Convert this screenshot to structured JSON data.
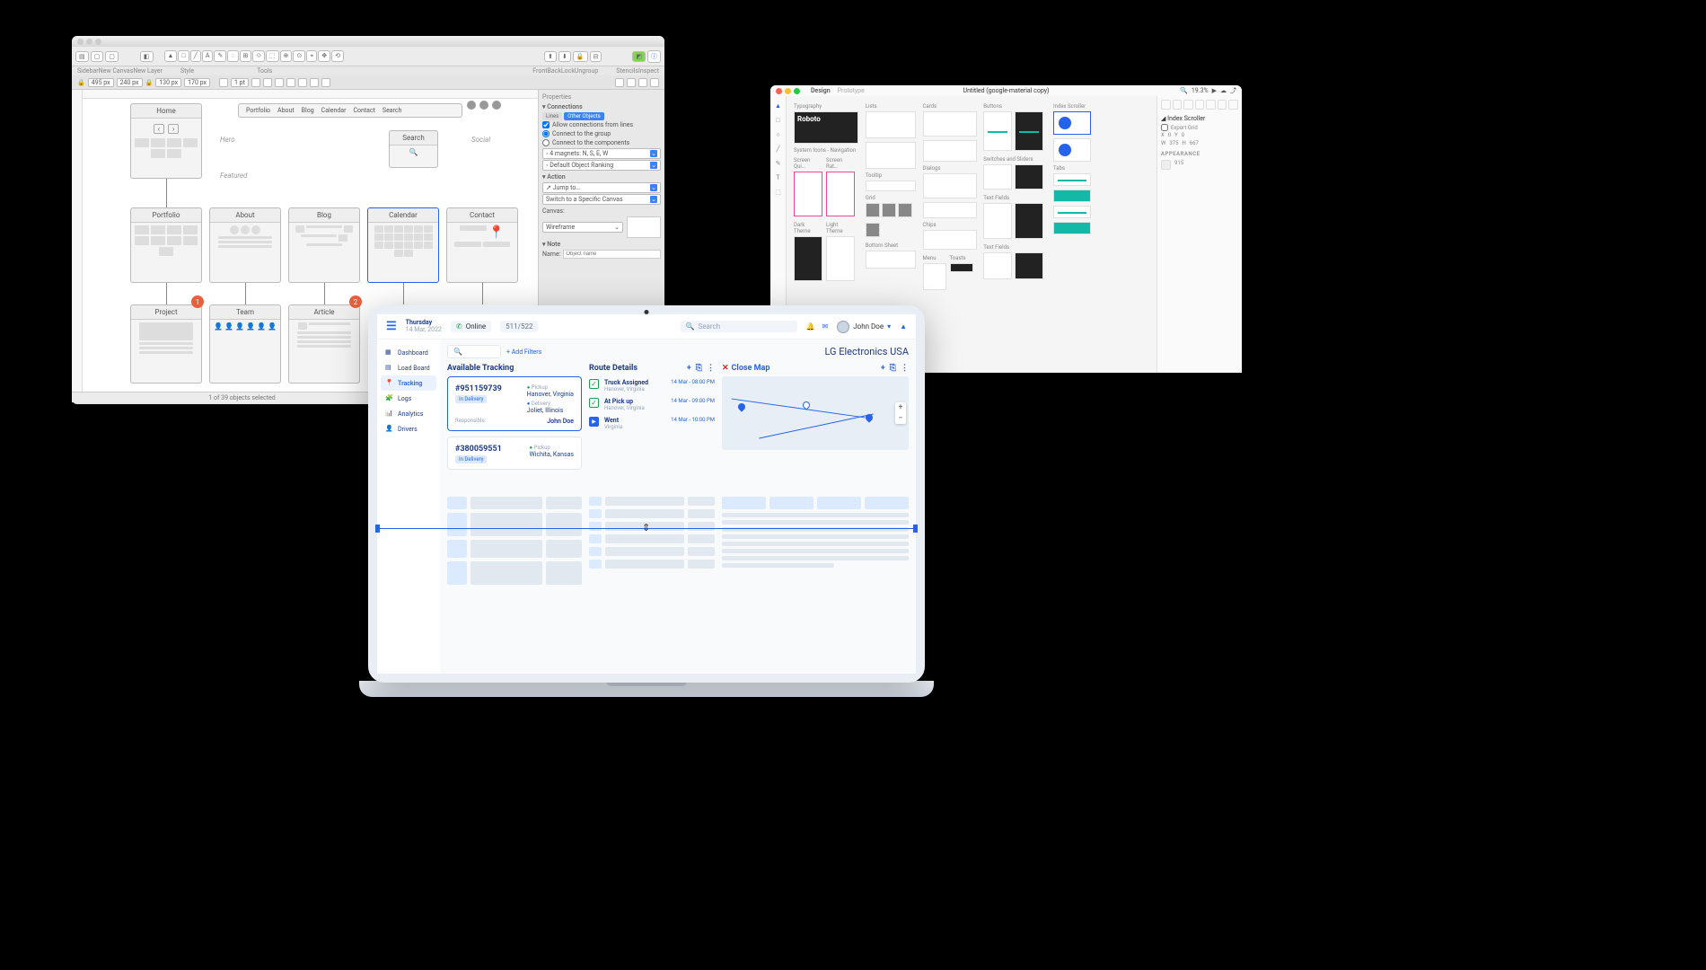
{
  "win1": {
    "toolbar_labels": {
      "sidebar": "Sidebar",
      "new_canvas": "New Canvas",
      "new_layer": "New Layer",
      "style": "Style",
      "tools": "Tools",
      "front": "Front",
      "back": "Back",
      "lock": "Lock",
      "ungroup": "Ungroup",
      "stencils": "Stencils",
      "inspect": "Inspect"
    },
    "optrow": {
      "x": "495 px",
      "y": "240 px",
      "w": "130 px",
      "h": "170 px",
      "stroke": "1 pt"
    },
    "wf": {
      "nav": [
        "Portfolio",
        "About",
        "Blog",
        "Calendar",
        "Contact",
        "Search"
      ],
      "home": "Home",
      "search_box": "Search",
      "labels": {
        "hero": "Hero",
        "featured": "Featured",
        "social": "Social"
      },
      "row1": [
        "Portfolio",
        "About",
        "Blog",
        "Calendar",
        "Contact"
      ],
      "row2": [
        "Project",
        "Team",
        "Article"
      ],
      "badge1": "1",
      "badge2": "2"
    },
    "status": "1 of 39 objects selected",
    "props": {
      "properties": "Properties",
      "connections": "Connections",
      "lines": "Lines",
      "other": "Other Objects",
      "allow": "Allow connections from lines",
      "c_group": "Connect to the group",
      "c_comp": "Connect to the components",
      "magnets": "4 magnets: N, S, E, W",
      "rank": "Default Object Ranking",
      "action": "Action",
      "jump": "Jump to…",
      "switch": "Switch to a Specific Canvas",
      "canvas": "Canvas:",
      "canvas_val": "Wireframe",
      "note": "Note",
      "name": "Name:",
      "name_ph": "Object name"
    }
  },
  "win2": {
    "tabs": {
      "design": "Design",
      "prototype": "Prototype"
    },
    "title": "Untitled (google-material copy)",
    "zoom": "19.3%",
    "sections": {
      "typography": "Typography",
      "lists": "Lists",
      "cards": "Cards",
      "buttons": "Buttons",
      "index": "Index Scroller",
      "sys_icons": "System Icons - Navigation",
      "dialogs": "Dialogs",
      "switches": "Switches and Sliders",
      "tabs": "Tabs",
      "screen_qui": "Screen Qui…",
      "screen_rat": "Screen Rat…",
      "tooltip": "Tooltip",
      "grid": "Grid",
      "dark": "Dark Theme",
      "light": "Light Theme",
      "chips": "Chips",
      "textfields": "Text Fields",
      "bottom": "Bottom Sheet",
      "menu": "Menu",
      "toasts": "Toasts",
      "textfields2": "Text Fields",
      "roboto": "Roboto"
    },
    "inspect": {
      "index": "Index Scroller",
      "export": "Export Grid",
      "appearance": "APPEARANCE",
      "x": "X",
      "y": "Y",
      "w": "W",
      "h": "H",
      "vals": {
        "x": "0",
        "y": "0",
        "w": "375",
        "h": "667"
      }
    }
  },
  "dash": {
    "date": {
      "day": "Thursday",
      "full": "14 Mar, 2022"
    },
    "online": "Online",
    "count": "511/522",
    "search_ph": "Search",
    "user": "John Doe",
    "sidebar": [
      {
        "icon": "dashboard",
        "label": "Dashboard"
      },
      {
        "icon": "board",
        "label": "Load Board"
      },
      {
        "icon": "tracking",
        "label": "Tracking"
      },
      {
        "icon": "logs",
        "label": "Logs"
      },
      {
        "icon": "analytics",
        "label": "Analytics"
      },
      {
        "icon": "drivers",
        "label": "Drivers"
      }
    ],
    "add_filters": "Add Filters",
    "company": "LG Electronics USA",
    "col1_title": "Available Tracking",
    "col2_title": "Route Details",
    "close_map": "Close Map",
    "card1": {
      "num": "#951159739",
      "tag": "In Delivery",
      "resp_lbl": "Responsible:",
      "resp": "John Doe",
      "pickup_lbl": "Pickup",
      "pickup": "Hanover, Virginia",
      "del_lbl": "Delivery",
      "del": "Joliet, Illinois"
    },
    "card2": {
      "num": "#380059551",
      "tag": "In Delivery",
      "pickup_lbl": "Pickup",
      "pickup": "Wichita, Kansas"
    },
    "route": [
      {
        "title": "Truck Assigned",
        "sub": "Hanover, Virginia",
        "time": "14 Mar - 08:00 PM",
        "state": "done"
      },
      {
        "title": "At Pick up",
        "sub": "Hanover, Virginia",
        "time": "14 Mar - 09:00 PM",
        "state": "done"
      },
      {
        "title": "Went",
        "sub": "Virginia",
        "time": "14 Mar - 10:00 PM",
        "state": "now"
      }
    ]
  }
}
